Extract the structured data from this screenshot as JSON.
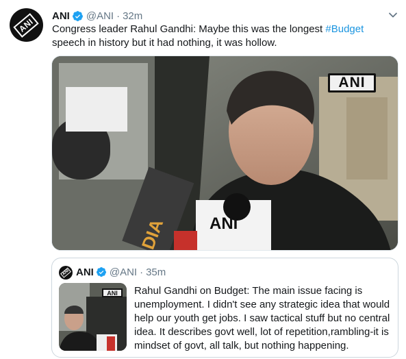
{
  "tweet": {
    "avatar_text": "ANI",
    "name": "ANI",
    "handle": "@ANI",
    "separator": "·",
    "time": "32m",
    "text_before": "Congress leader Rahul Gandhi: Maybe this was the longest ",
    "hashtag": "#Budget",
    "text_after": " speech in history but it had nothing, it was hollow.",
    "media_watermark": "ANI",
    "mic_labels": [
      "ANI",
      "DIA"
    ]
  },
  "quoted_tweet": {
    "avatar_text": "ANI",
    "name": "ANI",
    "handle": "@ANI",
    "separator": "·",
    "time": "35m",
    "thumb_watermark": "ANI",
    "text": "Rahul Gandhi on Budget: The main issue facing is unemployment. I didn't see any strategic idea that would help our youth get jobs. I saw tactical stuff but no central idea. It describes govt well, lot of repetition,rambling-it is mindset of govt, all talk, but nothing happening."
  },
  "colors": {
    "text": "#14171a",
    "secondary": "#657786",
    "link": "#1b95e0",
    "verified": "#1da1f2",
    "border": "#ccd6dd"
  },
  "icons": {
    "verified": "verified-badge-icon",
    "caret": "chevron-down-icon"
  }
}
